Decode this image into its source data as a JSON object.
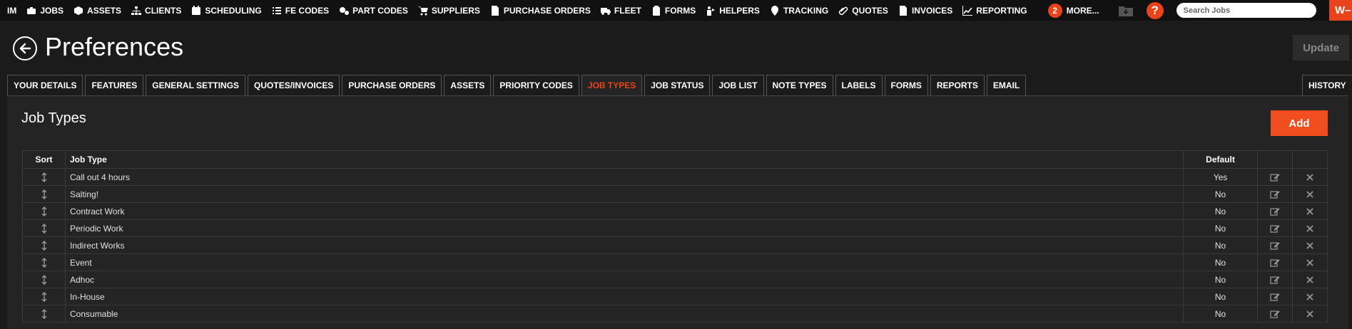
{
  "nav": {
    "items": [
      {
        "label": "IM",
        "icon": ""
      },
      {
        "label": "JOBS",
        "icon": "briefcase-icon"
      },
      {
        "label": "ASSETS",
        "icon": "cube-icon"
      },
      {
        "label": "CLIENTS",
        "icon": "sitemap-icon"
      },
      {
        "label": "SCHEDULING",
        "icon": "calendar-icon"
      },
      {
        "label": "FE CODES",
        "icon": "list-check-icon"
      },
      {
        "label": "PART CODES",
        "icon": "cogs-icon"
      },
      {
        "label": "SUPPLIERS",
        "icon": "cart-icon"
      },
      {
        "label": "PURCHASE ORDERS",
        "icon": "file-dollar-icon"
      },
      {
        "label": "FLEET",
        "icon": "truck-icon"
      },
      {
        "label": "FORMS",
        "icon": "clipboard-icon"
      },
      {
        "label": "HELPERS",
        "icon": "helper-icon"
      },
      {
        "label": "TRACKING",
        "icon": "map-pin-icon"
      },
      {
        "label": "QUOTES",
        "icon": "paperclip-icon"
      },
      {
        "label": "INVOICES",
        "icon": "file-text-icon"
      },
      {
        "label": "REPORTING",
        "icon": "chart-icon"
      }
    ],
    "more_count": "2",
    "more_label": "MORE...",
    "help_glyph": "?",
    "search_placeholder": "Search Jobs",
    "brand_text": "W–"
  },
  "header": {
    "title": "Preferences",
    "update_label": "Update"
  },
  "tabs": [
    {
      "label": "YOUR DETAILS"
    },
    {
      "label": "FEATURES"
    },
    {
      "label": "GENERAL SETTINGS"
    },
    {
      "label": "QUOTES/INVOICES"
    },
    {
      "label": "PURCHASE ORDERS"
    },
    {
      "label": "ASSETS"
    },
    {
      "label": "PRIORITY CODES"
    },
    {
      "label": "JOB TYPES",
      "active": true
    },
    {
      "label": "JOB STATUS"
    },
    {
      "label": "JOB LIST"
    },
    {
      "label": "NOTE TYPES"
    },
    {
      "label": "LABELS"
    },
    {
      "label": "FORMS"
    },
    {
      "label": "REPORTS"
    },
    {
      "label": "EMAIL"
    }
  ],
  "history_label": "HISTORY",
  "section": {
    "title": "Job Types",
    "add_label": "Add"
  },
  "table": {
    "headers": {
      "sort": "Sort",
      "type": "Job Type",
      "default": "Default"
    },
    "rows": [
      {
        "type": "Call out 4 hours",
        "default": "Yes"
      },
      {
        "type": "Salting!",
        "default": "No"
      },
      {
        "type": "Contract Work",
        "default": "No"
      },
      {
        "type": "Periodic Work",
        "default": "No"
      },
      {
        "type": "Indirect Works",
        "default": "No"
      },
      {
        "type": "Event",
        "default": "No"
      },
      {
        "type": "Adhoc",
        "default": "No"
      },
      {
        "type": "In-House",
        "default": "No"
      },
      {
        "type": "Consumable",
        "default": "No"
      }
    ]
  },
  "colors": {
    "accent": "#e8431a",
    "background": "#1b1b1b",
    "panel": "#242424"
  }
}
